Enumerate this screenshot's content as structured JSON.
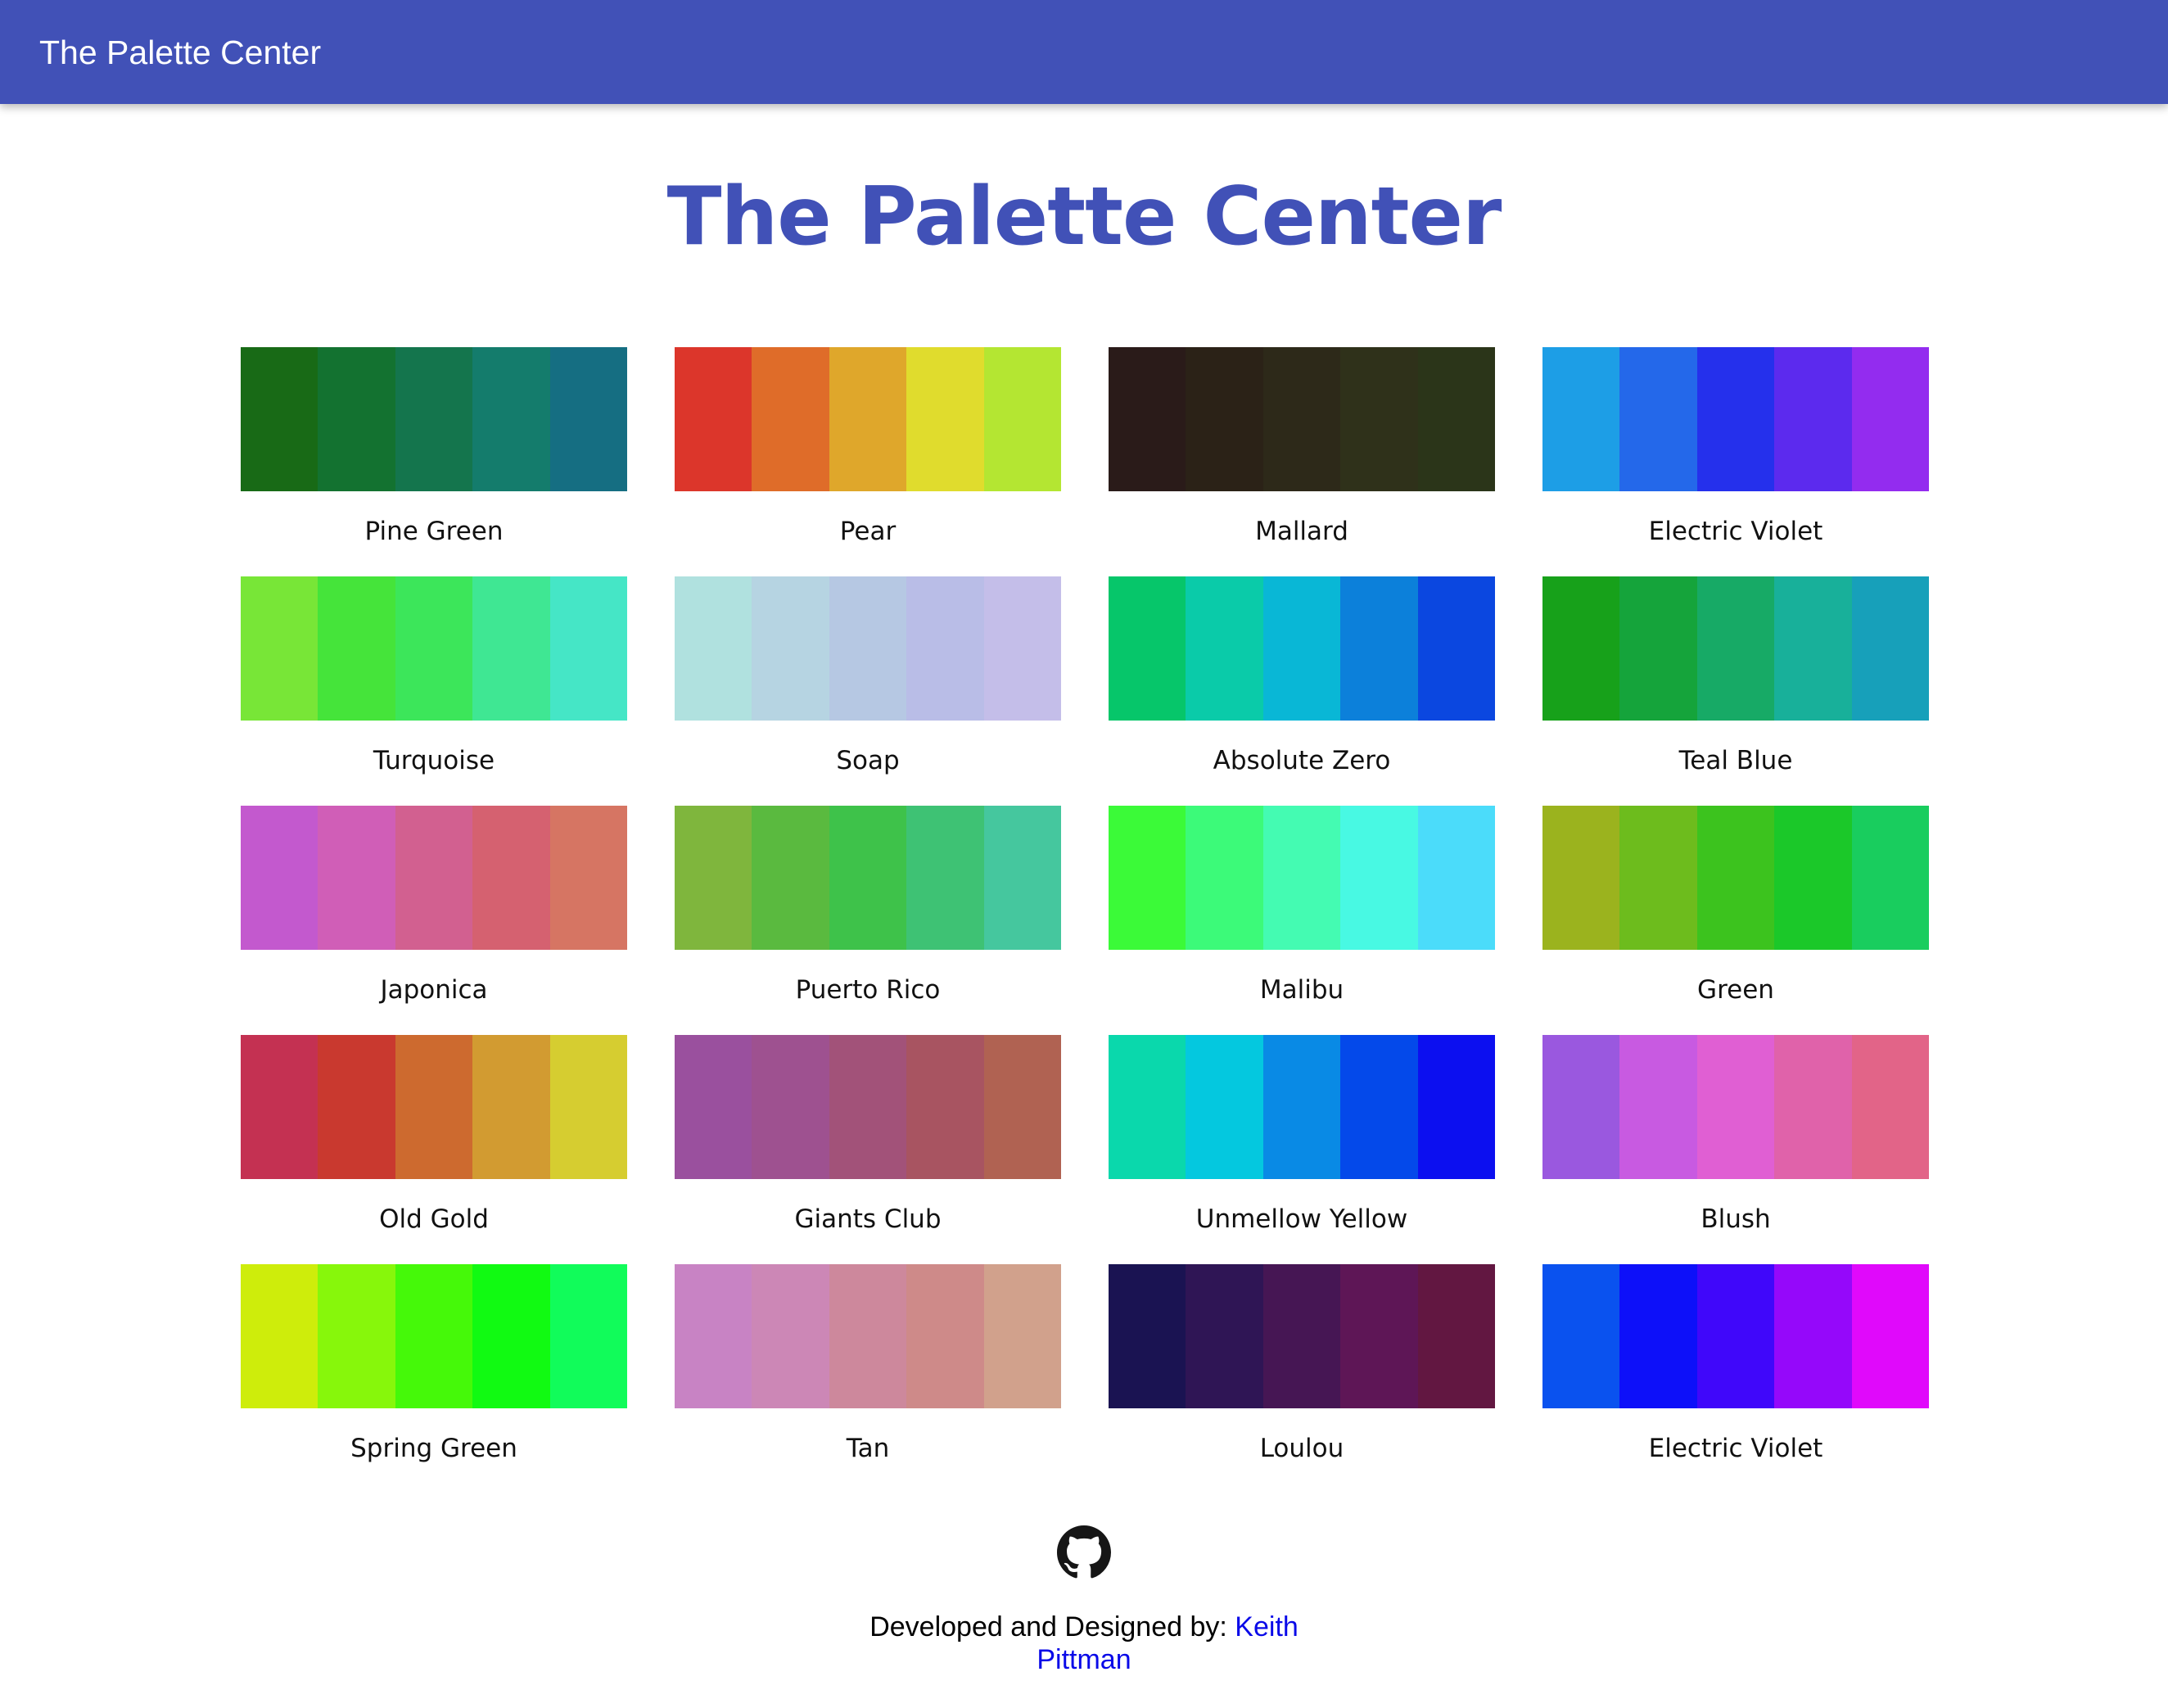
{
  "appbar": {
    "title": "The Palette Center"
  },
  "page": {
    "heading": "The Palette Center"
  },
  "palettes": [
    {
      "name": "Pine Green",
      "colors": [
        "#186a16",
        "#137230",
        "#14754d",
        "#147c6c",
        "#156e82"
      ]
    },
    {
      "name": "Pear",
      "colors": [
        "#dc362b",
        "#df6c29",
        "#dfa72b",
        "#e0dc2d",
        "#b4e632"
      ]
    },
    {
      "name": "Mallard",
      "colors": [
        "#2a1b19",
        "#2b2217",
        "#2d2919",
        "#2f311a",
        "#2b3519"
      ]
    },
    {
      "name": "Electric Violet",
      "colors": [
        "#1d9ee6",
        "#2468ea",
        "#2530ec",
        "#5c2aee",
        "#932cef"
      ]
    },
    {
      "name": "Turquoise",
      "colors": [
        "#78e637",
        "#45e43a",
        "#3ce65a",
        "#3fe793",
        "#45e6c6"
      ]
    },
    {
      "name": "Soap",
      "colors": [
        "#b0e1df",
        "#b6d4e2",
        "#b6c8e3",
        "#b9bde7",
        "#c4bee9"
      ]
    },
    {
      "name": "Absolute Zero",
      "colors": [
        "#06c66a",
        "#0acba9",
        "#09b7d6",
        "#0c80da",
        "#0b47e0"
      ]
    },
    {
      "name": "Teal Blue",
      "colors": [
        "#17a11a",
        "#15a43b",
        "#17aa66",
        "#18b09a",
        "#17a0ba"
      ]
    },
    {
      "name": "Japonica",
      "colors": [
        "#c359ce",
        "#d05eb7",
        "#d26090",
        "#d56170",
        "#d67563"
      ]
    },
    {
      "name": "Puerto Rico",
      "colors": [
        "#7fb63d",
        "#5aba3f",
        "#3ec24a",
        "#3ec274",
        "#45c79e"
      ]
    },
    {
      "name": "Malibu",
      "colors": [
        "#3bfa38",
        "#3cfa79",
        "#44fbb2",
        "#48f9e3",
        "#4bdcfa"
      ]
    },
    {
      "name": "Green",
      "colors": [
        "#9bb31e",
        "#6dbc1d",
        "#3cc31e",
        "#1bc829",
        "#19cd5e"
      ]
    },
    {
      "name": "Old Gold",
      "colors": [
        "#c43152",
        "#c9392f",
        "#cd6a2f",
        "#d29b31",
        "#d6cd30"
      ]
    },
    {
      "name": "Giants Club",
      "colors": [
        "#9a509e",
        "#9e5190",
        "#a25279",
        "#a85461",
        "#b06252"
      ]
    },
    {
      "name": "Unmellow Yellow",
      "colors": [
        "#0ad8ac",
        "#04c8df",
        "#098ae5",
        "#0449ea",
        "#0c0ff0"
      ]
    },
    {
      "name": "Blush",
      "colors": [
        "#9a58df",
        "#c85ae1",
        "#e05fd3",
        "#e062aa",
        "#e26488"
      ]
    },
    {
      "name": "Spring Green",
      "colors": [
        "#ceed0b",
        "#87f70b",
        "#45f909",
        "#11fa12",
        "#11fc5a"
      ]
    },
    {
      "name": "Tan",
      "colors": [
        "#c883c4",
        "#cc87b6",
        "#cd889c",
        "#ce8a89",
        "#d1a18c"
      ]
    },
    {
      "name": "Loulou",
      "colors": [
        "#1a1352",
        "#2f1555",
        "#461654",
        "#5e1656",
        "#621741"
      ]
    },
    {
      "name": "Electric Violet",
      "colors": [
        "#0a52ef",
        "#0d10f9",
        "#4007fa",
        "#9508fa",
        "#e009fb"
      ]
    }
  ],
  "footer": {
    "github_icon": "github-icon",
    "credit_prefix": "Developed and Designed by: ",
    "author_link_text": "Keith Pittman",
    "author_link_color": "#0a0ae8"
  },
  "colors": {
    "primary": "#4151b7"
  }
}
